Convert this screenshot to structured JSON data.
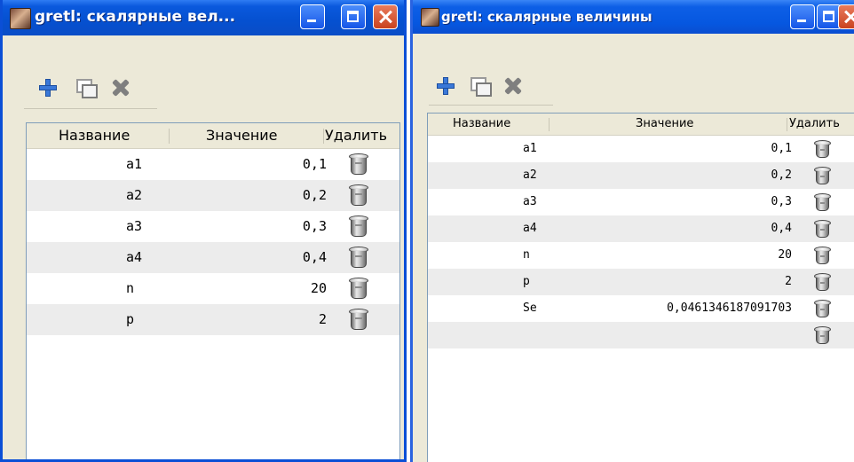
{
  "left_window": {
    "title": "gretl: скалярные вел...",
    "columns": [
      "Название",
      "Значение",
      "Удалить"
    ],
    "rows": [
      {
        "name": "a1",
        "value": "0,1"
      },
      {
        "name": "a2",
        "value": "0,2"
      },
      {
        "name": "a3",
        "value": "0,3"
      },
      {
        "name": "a4",
        "value": "0,4"
      },
      {
        "name": "n",
        "value": "20"
      },
      {
        "name": "p",
        "value": "2"
      }
    ]
  },
  "right_window": {
    "title": "gretl: скалярные величины",
    "columns": [
      "Название",
      "Значение",
      "Удалить"
    ],
    "rows": [
      {
        "name": "a1",
        "value": "0,1"
      },
      {
        "name": "a2",
        "value": "0,2"
      },
      {
        "name": "a3",
        "value": "0,3"
      },
      {
        "name": "a4",
        "value": "0,4"
      },
      {
        "name": "n",
        "value": "20"
      },
      {
        "name": "p",
        "value": "2"
      },
      {
        "name": "Se",
        "value": "0,0461346187091703"
      },
      {
        "name": "",
        "value": ""
      }
    ]
  },
  "icons": {
    "titlebar": [
      "app-icon",
      "minimize-icon",
      "maximize-icon",
      "close-icon"
    ],
    "toolbar": [
      "add-icon",
      "copy-icon",
      "delete-icon"
    ],
    "row_action": "trash-bin-icon"
  },
  "colors": {
    "titlebar_blue": "#0550d0",
    "close_button": "#c9431f",
    "row_alt": "#ececec",
    "window_bg": "#ece9d8"
  }
}
